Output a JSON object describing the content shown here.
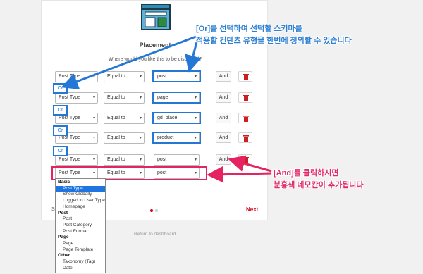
{
  "panel": {
    "title": "Placement",
    "question": "Where would you like this to be displayed?",
    "skip_label": "Sk",
    "next_label": "Next",
    "footer_link": "Return to dashboard"
  },
  "rules": [
    {
      "field": "Post Type",
      "operator": "Equal to",
      "value": "post",
      "and_label": "And"
    },
    {
      "field": "Post Type",
      "operator": "Equal to",
      "value": "page",
      "and_label": "And"
    },
    {
      "field": "Post Type",
      "operator": "Equal to",
      "value": "gd_place",
      "and_label": "And"
    },
    {
      "field": "Post Type",
      "operator": "Equal to",
      "value": "product",
      "and_label": "And"
    },
    {
      "field": "Post Type",
      "operator": "Equal to",
      "value": "post",
      "and_label": "And"
    },
    {
      "field": "Post Type",
      "operator": "Equal to",
      "value": "post"
    }
  ],
  "or_label": "Or",
  "dropdown": {
    "groups": [
      {
        "label": "Basic",
        "options": [
          "Post Type",
          "Show Globally",
          "Logged in User Type",
          "Homepage"
        ]
      },
      {
        "label": "Post",
        "options": [
          "Post",
          "Post Category",
          "Post Format"
        ]
      },
      {
        "label": "Page",
        "options": [
          "Page",
          "Page Template"
        ]
      },
      {
        "label": "Other",
        "options": [
          "Taxonomy (Tag)",
          "Date"
        ]
      }
    ],
    "selected": "Post Type"
  },
  "annotations": {
    "or_line1": "[Or]를 선택하여 선택할 스키마를",
    "or_line2": "적용할 컨텐츠 유형을 한번에 정의할 수 있습니다",
    "and_line1": "[And]를 클릭하시면",
    "and_line2": "분홍색 네모칸이 추가됩니다"
  },
  "colors": {
    "annotation_blue": "#2477d4",
    "annotation_pink": "#e52360",
    "accent_red": "#d0021b",
    "delete_icon": "#cc1f1f"
  }
}
